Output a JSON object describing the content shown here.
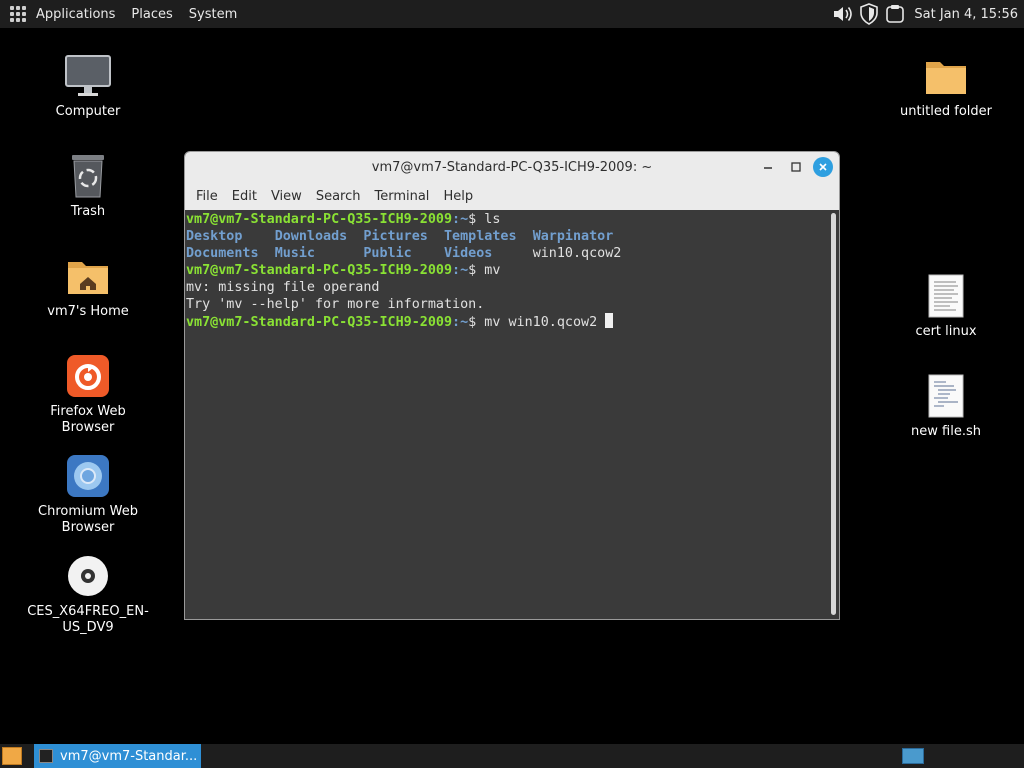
{
  "top_panel": {
    "menus": [
      "Applications",
      "Places",
      "System"
    ],
    "tray_icons": [
      "volume-icon",
      "shield-icon",
      "clipboard-icon"
    ],
    "clock": "Sat Jan  4, 15:56"
  },
  "desktop_left": [
    {
      "label": "Computer",
      "icon": "computer-icon"
    },
    {
      "label": "Trash",
      "icon": "trash-icon"
    },
    {
      "label": "vm7's Home",
      "icon": "home-folder-icon"
    },
    {
      "label": "Firefox Web Browser",
      "icon": "firefox-icon"
    },
    {
      "label": "Chromium Web Browser",
      "icon": "chromium-icon"
    },
    {
      "label": "CES_X64FREO_EN-US_DV9",
      "icon": "disc-icon"
    }
  ],
  "desktop_right": [
    {
      "label": "untitled folder",
      "icon": "folder-icon"
    },
    {
      "label": "cert linux",
      "icon": "text-file-icon"
    },
    {
      "label": "new file.sh",
      "icon": "script-file-icon"
    }
  ],
  "window": {
    "title": "vm7@vm7-Standard-PC-Q35-ICH9-2009: ~",
    "menu": [
      "File",
      "Edit",
      "View",
      "Search",
      "Terminal",
      "Help"
    ]
  },
  "terminal": {
    "prompt_user": "vm7@vm7-Standard-PC-Q35-ICH9-2009",
    "prompt_path": "~",
    "cmd1": "ls",
    "ls_row1": [
      "Desktop",
      "Downloads",
      "Pictures",
      "Templates",
      "Warpinator"
    ],
    "ls_row2": [
      "Documents",
      "Music",
      "Public",
      "Videos",
      "win10.qcow2"
    ],
    "cmd2": "mv",
    "err1": "mv: missing file operand",
    "err2": "Try 'mv --help' for more information.",
    "cmd3": "mv win10.qcow2 "
  },
  "taskbar": {
    "task_label": "vm7@vm7-Standar..."
  },
  "colors": {
    "prompt_green": "#8ae234",
    "dir_blue": "#729fcf",
    "terminal_bg": "#3a3a3a",
    "taskbar_active": "#2e8fd5"
  }
}
